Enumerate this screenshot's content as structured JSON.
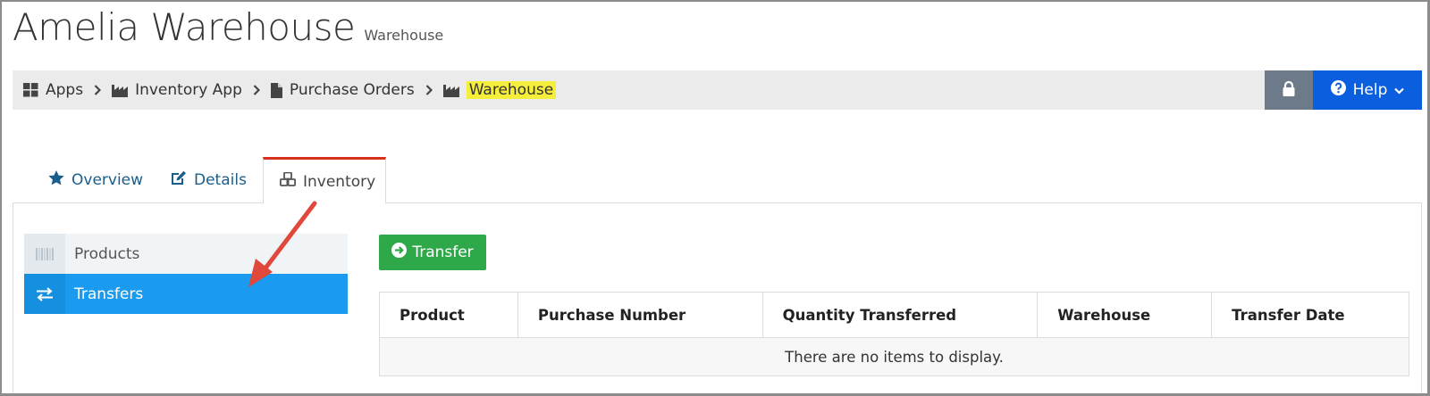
{
  "header": {
    "title": "Amelia Warehouse",
    "subtitle": "Warehouse"
  },
  "breadcrumb": [
    {
      "label": "Apps",
      "icon": "grid-icon"
    },
    {
      "label": "Inventory App",
      "icon": "factory-icon"
    },
    {
      "label": "Purchase Orders",
      "icon": "document-icon"
    },
    {
      "label": "Warehouse",
      "icon": "factory-icon",
      "highlight": "#f5ee3a"
    }
  ],
  "toolbar": {
    "help_label": "Help"
  },
  "tabs": [
    {
      "label": "Overview",
      "icon": "star-icon"
    },
    {
      "label": "Details",
      "icon": "edit-icon"
    },
    {
      "label": "Inventory",
      "icon": "cubes-icon",
      "active": true
    }
  ],
  "sidenav": [
    {
      "label": "Products",
      "icon": "barcode-icon"
    },
    {
      "label": "Transfers",
      "icon": "exchange-icon",
      "active": true
    }
  ],
  "actions": {
    "transfer_label": "Transfer"
  },
  "table": {
    "columns": [
      "Product",
      "Purchase Number",
      "Quantity Transferred",
      "Warehouse",
      "Transfer Date"
    ],
    "empty_message": "There are no items to display."
  },
  "colors": {
    "accent": "#0b5fde",
    "active_nav": "#1a9bf0",
    "transfer_button": "#2fa84a",
    "active_tab_border": "#d9301c",
    "annotation_arrow": "#e0483b"
  }
}
